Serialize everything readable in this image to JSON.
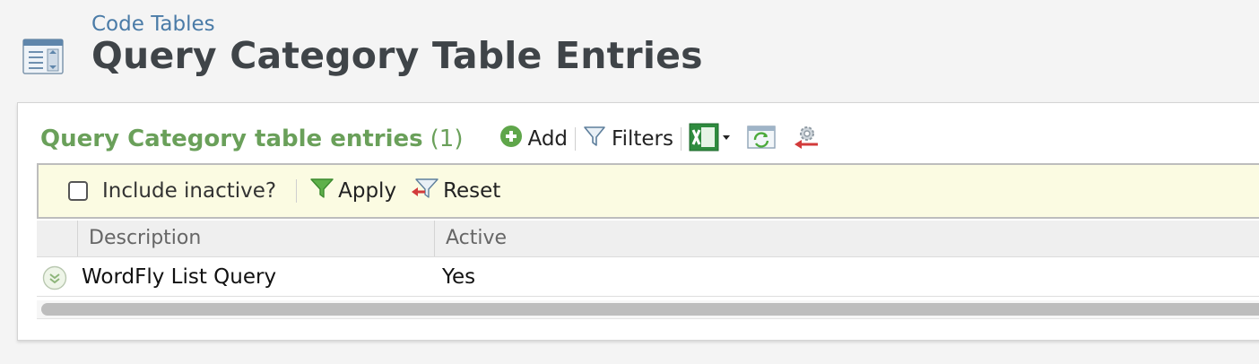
{
  "breadcrumb": "Code Tables",
  "page": {
    "title": "Query Category Table Entries",
    "icon": "code-table-icon"
  },
  "section": {
    "title": "Query Category table entries",
    "count": "(1)"
  },
  "toolbar": {
    "add_label": "Add",
    "filters_label": "Filters",
    "icons": [
      "add-icon",
      "filter-icon",
      "excel-export-icon",
      "refresh-icon",
      "settings-icon"
    ]
  },
  "filter_bar": {
    "include_inactive_label": "Include inactive?",
    "include_inactive_checked": false,
    "apply_label": "Apply",
    "reset_label": "Reset"
  },
  "grid": {
    "columns": [
      "Description",
      "Active"
    ],
    "rows": [
      {
        "description": "WordFly List Query",
        "active": "Yes"
      }
    ]
  },
  "colors": {
    "accent_green": "#6aa05a",
    "breadcrumb_blue": "#4a7ba7",
    "filter_bar_bg": "#fbfbe2",
    "title_gray": "#3f4448"
  }
}
